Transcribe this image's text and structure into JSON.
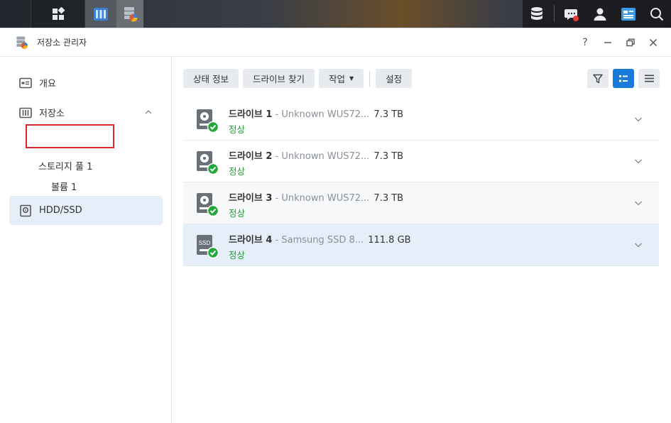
{
  "window": {
    "title": "저장소 관리자",
    "help": "?",
    "minimize": "—",
    "restore": "❐",
    "close": "✕"
  },
  "sidebar": {
    "overview": "개요",
    "storage": "저장소",
    "storage_pool": "스토리지 풀 1",
    "volume": "볼륨 1",
    "hdd_ssd": "HDD/SSD"
  },
  "toolbar": {
    "status_info": "상태 정보",
    "find_drive": "드라이브 찾기",
    "action": "작업",
    "settings": "설정"
  },
  "drives": [
    {
      "name": "드라이브 1",
      "model": " - Unknown WUS72...",
      "size": "7.3 TB",
      "status": "정상",
      "type": "hdd"
    },
    {
      "name": "드라이브 2",
      "model": " - Unknown WUS72...",
      "size": "7.3 TB",
      "status": "정상",
      "type": "hdd"
    },
    {
      "name": "드라이브 3",
      "model": " - Unknown WUS72...",
      "size": "7.3 TB",
      "status": "정상",
      "type": "hdd"
    },
    {
      "name": "드라이브 4",
      "model": " - Samsung SSD 8...",
      "size": "111.8 GB",
      "status": "정상",
      "type": "ssd"
    }
  ],
  "ssd_icon_label": "SSD",
  "colors": {
    "accent": "#1a7ad9",
    "status_ok": "#1e9e2e",
    "selected_bg": "#e5eef9",
    "highlight_box": "#d9262e"
  }
}
